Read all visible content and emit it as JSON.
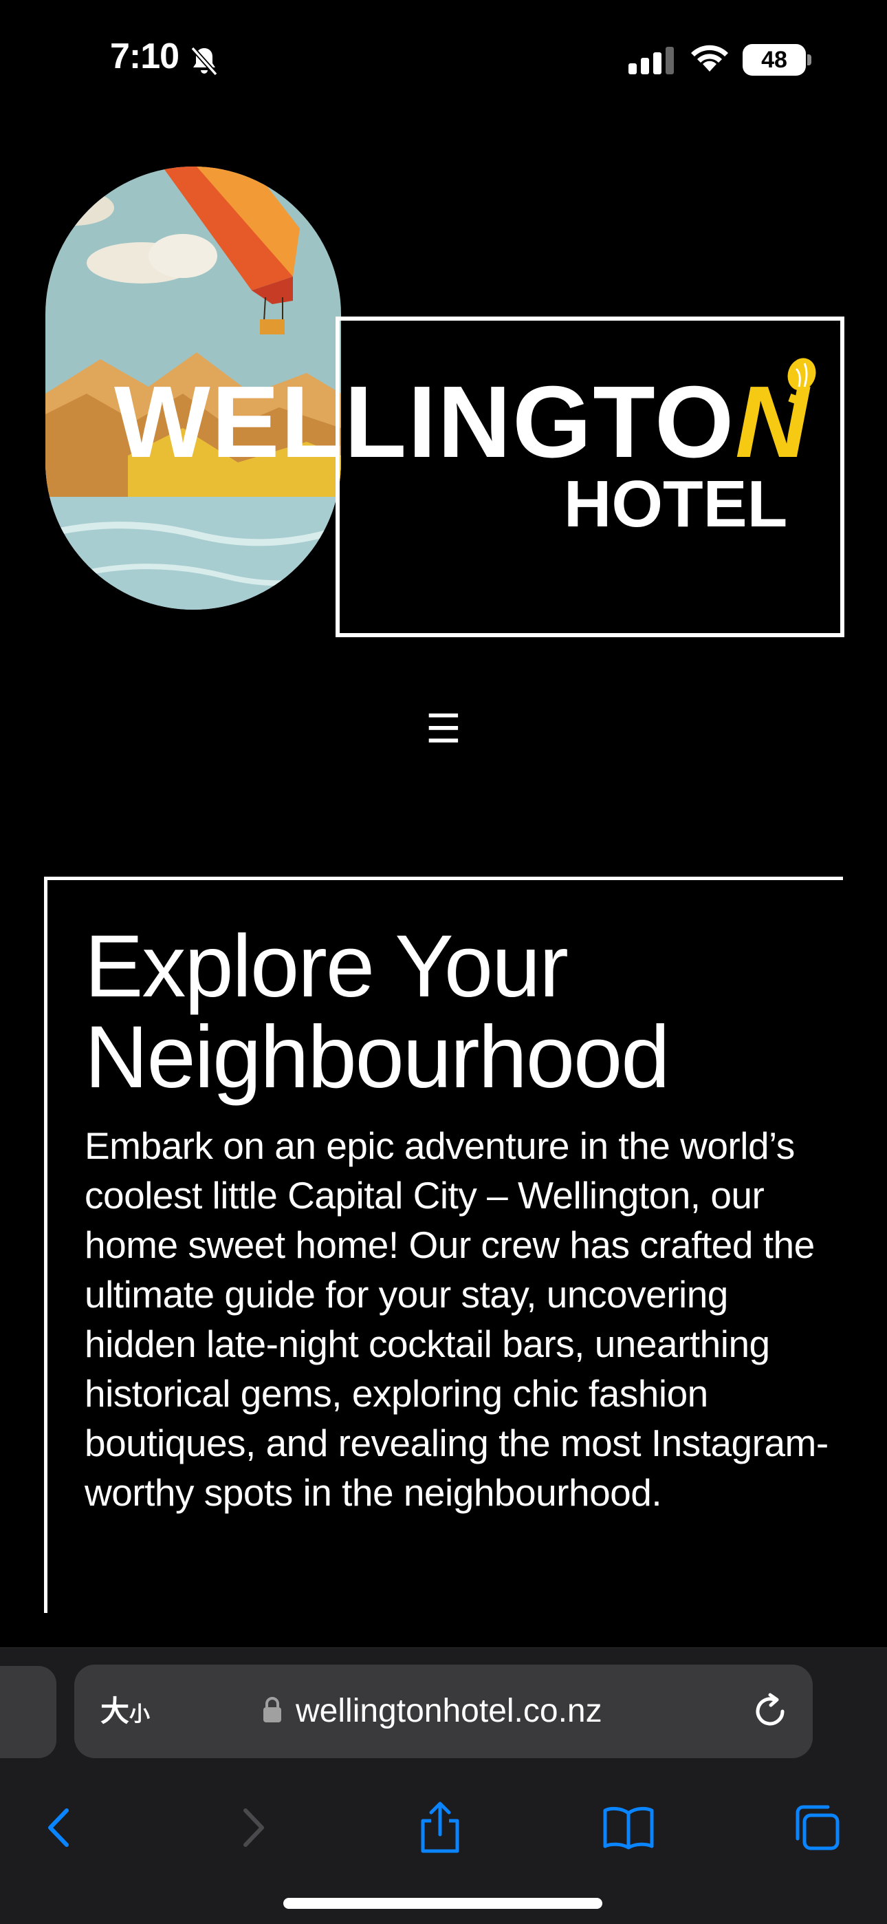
{
  "status_bar": {
    "time": "7:10",
    "battery": "48",
    "icons": [
      "bell-slash-icon",
      "cellular-signal-icon",
      "wifi-icon",
      "battery-icon"
    ]
  },
  "logo": {
    "word_main": "WELLINGTO",
    "word_accent": "N",
    "sub": "HOTEL",
    "accent_color": "#f6c912"
  },
  "menu": {
    "icon": "☰"
  },
  "content": {
    "title": "Explore Your Neighbourhood",
    "body": "Embark on an epic adventure in the world’s coolest little Capital City – Wellington, our home sweet home! Our crew has crafted the ultimate guide for your stay, uncovering hidden late-night cocktail bars, unearthing historical gems, exploring chic fashion boutiques, and revealing the most Instagram-worthy spots in the neighbourhood."
  },
  "browser": {
    "text_size_big": "大",
    "text_size_small": "小",
    "url": "wellingtonhotel.co.nz",
    "accent_color": "#0a84ff",
    "toolbar": [
      "back-icon",
      "forward-icon",
      "share-icon",
      "bookmarks-icon",
      "tabs-icon"
    ]
  }
}
